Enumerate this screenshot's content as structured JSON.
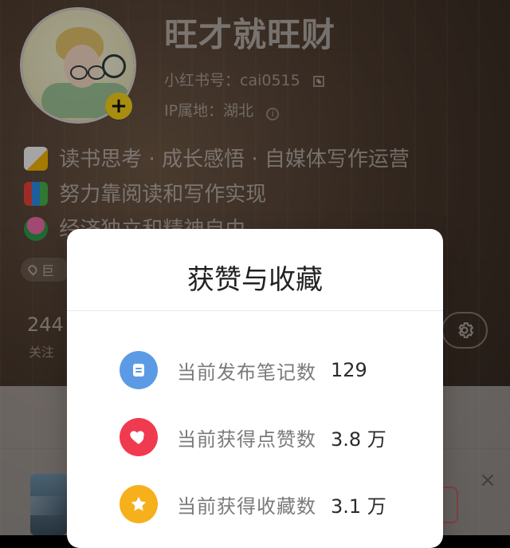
{
  "profile": {
    "display_name": "旺才就旺财",
    "redbook_id": "小红书号：cai0515",
    "ip_location": "IP属地：湖北",
    "bio_lines": [
      "读书思考 · 成长感悟 · 自媒体写作运营",
      "努力靠阅读和写作实现",
      "经济独立和精神自由"
    ],
    "tag_text": "巨",
    "stat_value": "244",
    "stat_label": "关注"
  },
  "modal": {
    "title": "获赞与收藏",
    "rows": [
      {
        "label": "当前发布笔记数",
        "value": "129",
        "icon": "note-icon",
        "color": "#5b9be6"
      },
      {
        "label": "当前获得点赞数",
        "value": "3.8 万",
        "icon": "heart-icon",
        "color": "#f03a4f"
      },
      {
        "label": "当前获得收藏数",
        "value": "3.1 万",
        "icon": "star-icon",
        "color": "#f6b01b"
      }
    ]
  },
  "icons": {
    "add": "plus-icon",
    "qr": "qr-code-icon",
    "info": "info-icon",
    "settings": "gear-icon",
    "close": "close-icon",
    "location": "location-pin-icon"
  }
}
